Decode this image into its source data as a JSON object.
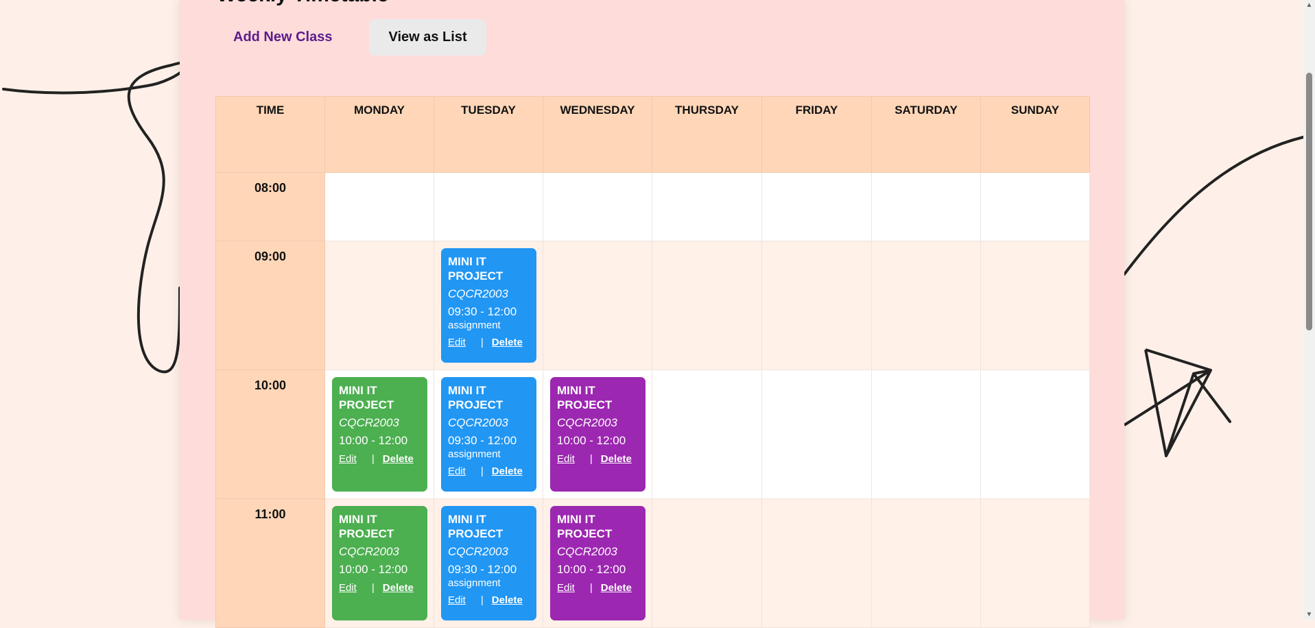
{
  "page": {
    "title": "Weekly Timetable"
  },
  "toolbar": {
    "add_label": "Add New Class",
    "view_list_label": "View as List"
  },
  "table": {
    "headers": [
      "TIME",
      "MONDAY",
      "TUESDAY",
      "WEDNESDAY",
      "THURSDAY",
      "FRIDAY",
      "SATURDAY",
      "SUNDAY"
    ],
    "times": [
      "08:00",
      "09:00",
      "10:00",
      "11:00"
    ]
  },
  "classes": {
    "tue_0900": {
      "title": "MINI IT PROJECT",
      "code": "CQCR2003",
      "time": "09:30 - 12:00",
      "note": "assignment",
      "edit": "Edit",
      "sep": "|",
      "delete": "Delete"
    },
    "mon_1000": {
      "title": "MINI IT PROJECT",
      "code": "CQCR2003",
      "time": "10:00 - 12:00",
      "edit": "Edit",
      "sep": "|",
      "delete": "Delete"
    },
    "tue_1000": {
      "title": "MINI IT PROJECT",
      "code": "CQCR2003",
      "time": "09:30 - 12:00",
      "note": "assignment",
      "edit": "Edit",
      "sep": "|",
      "delete": "Delete"
    },
    "wed_1000": {
      "title": "MINI IT PROJECT",
      "code": "CQCR2003",
      "time": "10:00 - 12:00",
      "edit": "Edit",
      "sep": "|",
      "delete": "Delete"
    },
    "mon_1100": {
      "title": "MINI IT PROJECT",
      "code": "CQCR2003",
      "time": "10:00 - 12:00",
      "edit": "Edit",
      "sep": "|",
      "delete": "Delete"
    },
    "tue_1100": {
      "title": "MINI IT PROJECT",
      "code": "CQCR2003",
      "time": "09:30 - 12:00",
      "note": "assignment",
      "edit": "Edit",
      "sep": "|",
      "delete": "Delete"
    },
    "wed_1100": {
      "title": "MINI IT PROJECT",
      "code": "CQCR2003",
      "time": "10:00 - 12:00",
      "edit": "Edit",
      "sep": "|",
      "delete": "Delete"
    }
  },
  "colors": {
    "monday": "#4caf50",
    "tuesday": "#2196f3",
    "wednesday": "#9c27b0",
    "header": "#ffd6b8",
    "panel": "#fedcda",
    "page_bg": "#fef0e8",
    "add_link": "#5b1c8c"
  }
}
